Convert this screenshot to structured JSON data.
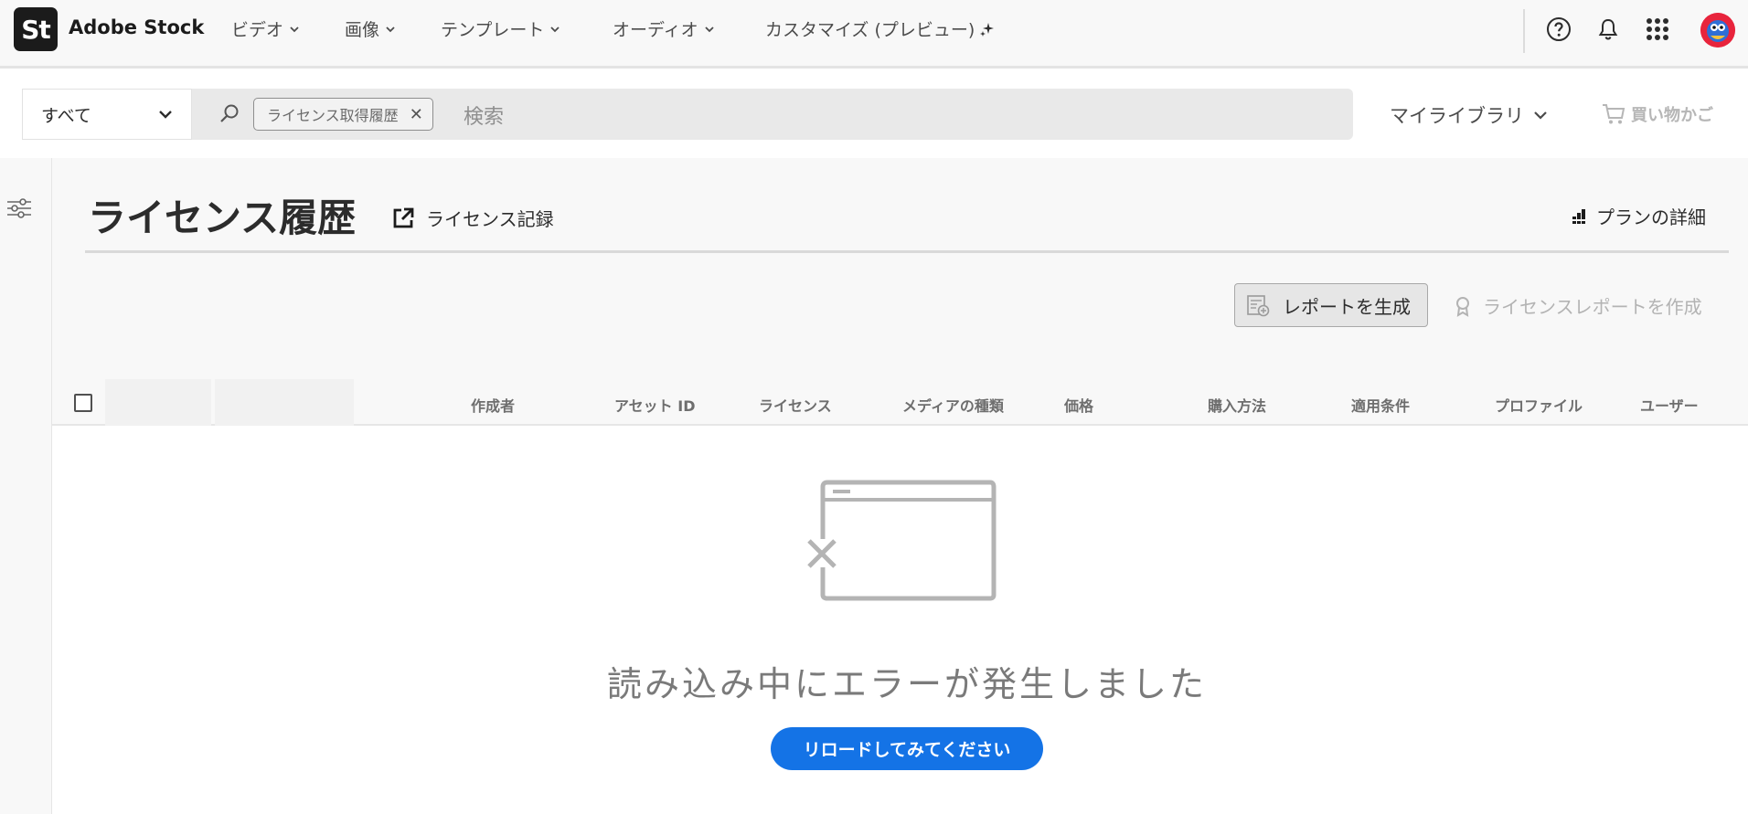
{
  "app": {
    "logo_text": "St",
    "brand": "Adobe Stock"
  },
  "nav": {
    "items": [
      {
        "label": "ビデオ"
      },
      {
        "label": "画像"
      },
      {
        "label": "テンプレート"
      },
      {
        "label": "オーディオ"
      },
      {
        "label": "カスタマイズ (プレビュー)"
      }
    ]
  },
  "header_icons": [
    "help-icon",
    "bell-icon",
    "apps-grid-icon",
    "avatar"
  ],
  "search": {
    "scope": "すべて",
    "chip": "ライセンス取得履歴",
    "placeholder": "検索"
  },
  "toolbar": {
    "my_library": "マイライブラリ",
    "cart": "買い物かご"
  },
  "page": {
    "title": "ライセンス履歴",
    "license_record": "ライセンス記録",
    "plan_details": "プランの詳細",
    "generate_report": "レポートを生成",
    "license_report": "ライセンスレポートを作成"
  },
  "table": {
    "columns": [
      "作成者",
      "アセット ID",
      "ライセンス",
      "メディアの種類",
      "価格",
      "購入方法",
      "適用条件",
      "プロファイル",
      "ユーザー"
    ]
  },
  "empty_state": {
    "message": "読み込み中にエラーが発生しました",
    "reload_button": "リロードしてみてください"
  },
  "colors": {
    "accent": "#1473e6",
    "logo_bg": "#1b1b1b",
    "avatar": "#e8243c"
  }
}
